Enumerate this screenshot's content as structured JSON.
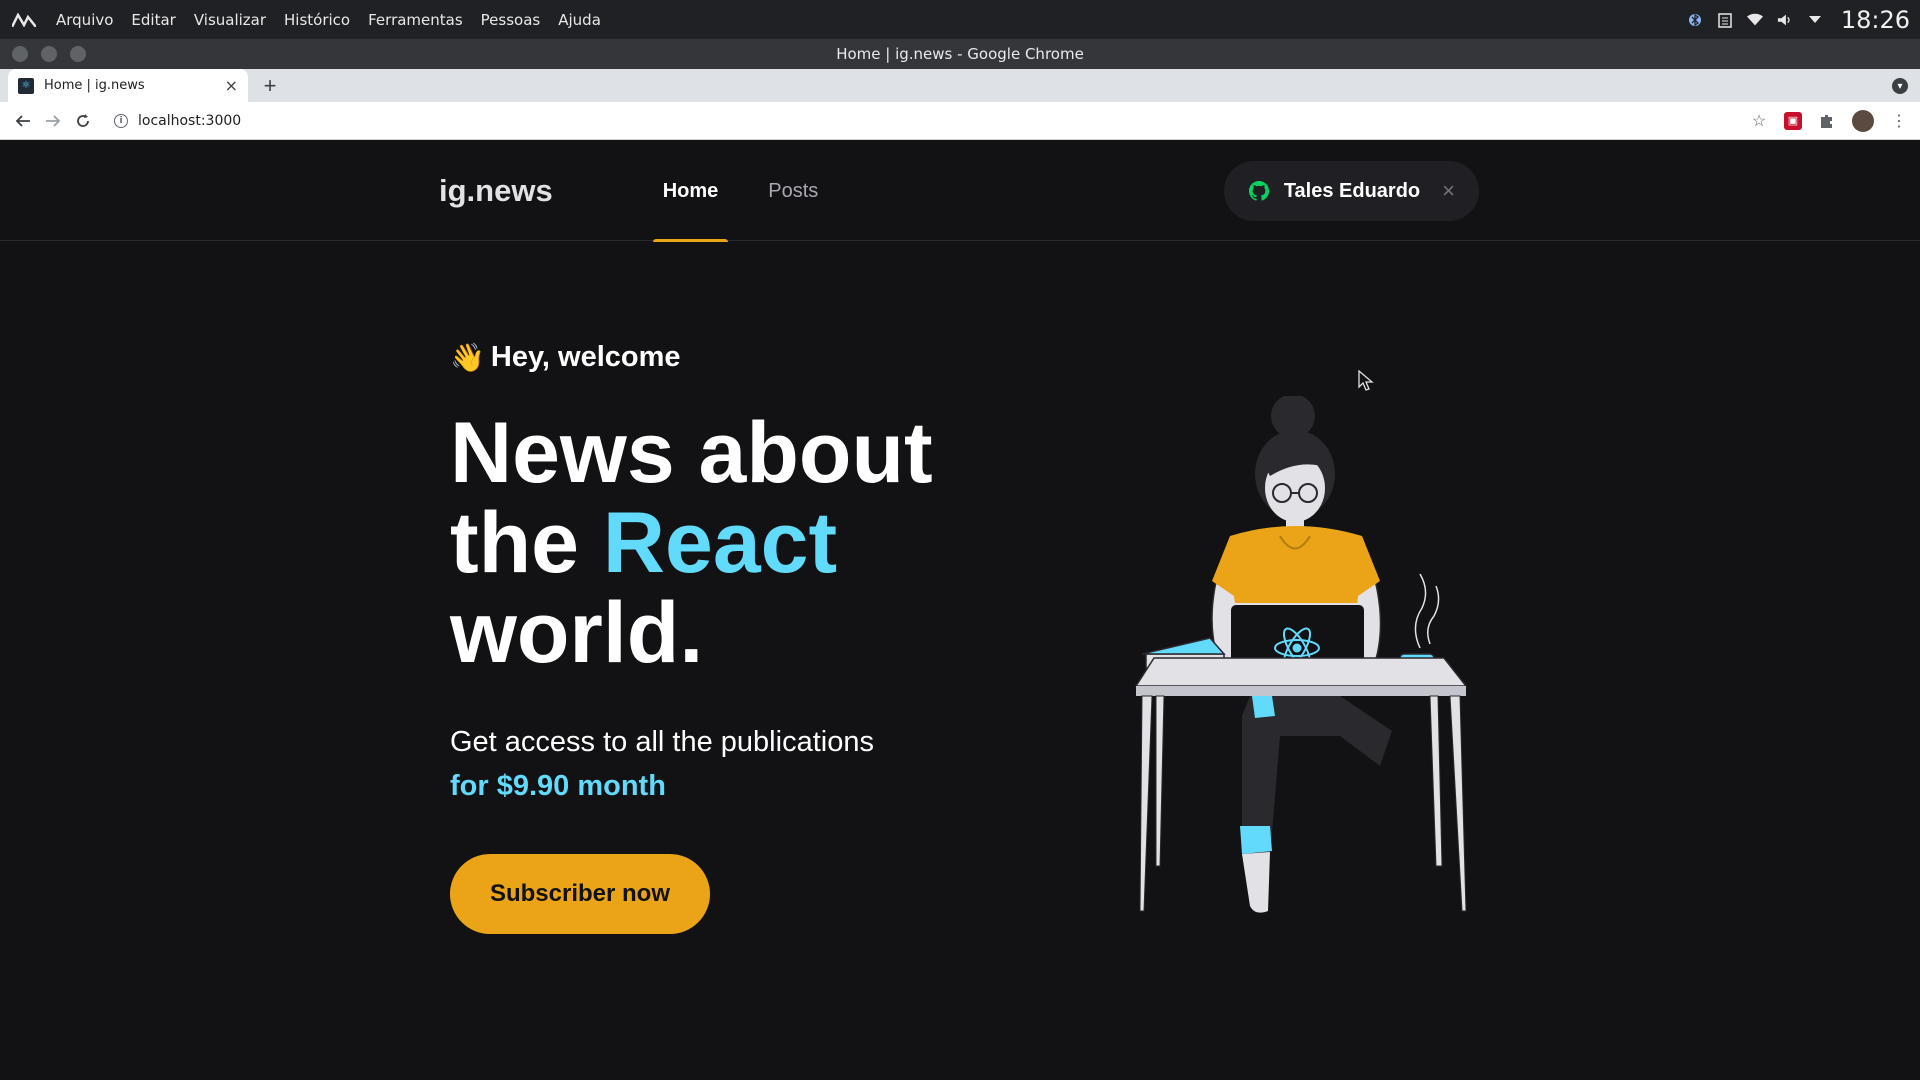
{
  "os": {
    "menu": [
      "Arquivo",
      "Editar",
      "Visualizar",
      "Histórico",
      "Ferramentas",
      "Pessoas",
      "Ajuda"
    ],
    "clock": "18:26",
    "tray_icons": [
      "bluetooth-icon",
      "clipboard-icon",
      "wifi-icon",
      "volume-icon",
      "dropdown-icon"
    ]
  },
  "browser": {
    "window_title": "Home | ig.news - Google Chrome",
    "tab_title": "Home | ig.news",
    "new_tab": "+",
    "url": "localhost:3000"
  },
  "app": {
    "logo": "ig.news",
    "nav": [
      {
        "label": "Home",
        "active": true
      },
      {
        "label": "Posts",
        "active": false
      }
    ],
    "user_name": "Tales Eduardo",
    "close_symbol": "×",
    "welcome": "Hey, welcome",
    "wave": "👋",
    "headline_line1": "News about",
    "headline_the": "the ",
    "headline_highlight": "React",
    "headline_line3": "world.",
    "sub_line1": "Get access to all the publications",
    "sub_price": "for $9.90 month",
    "cta_label": "Subscriber now"
  },
  "colors": {
    "background": "#121214",
    "accent_yellow": "#eba417",
    "accent_cyan": "#61dafb",
    "github_green": "#04d361"
  }
}
